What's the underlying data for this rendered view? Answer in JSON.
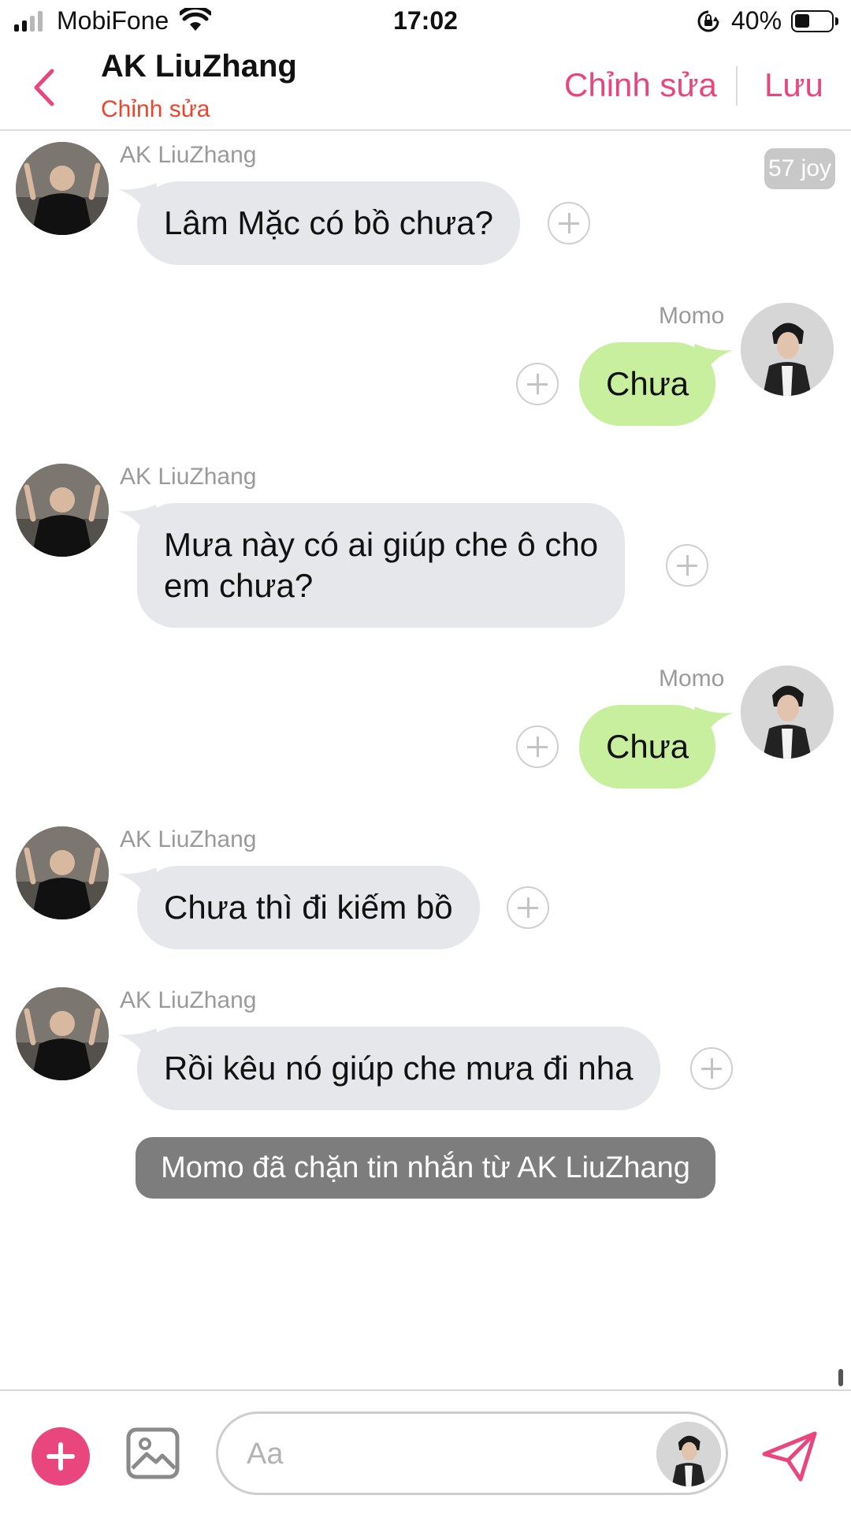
{
  "status_bar": {
    "carrier": "MobiFone",
    "time": "17:02",
    "battery_percent": "40%",
    "battery_level": 0.4,
    "signal_bars_active": 2,
    "icons": [
      "signal-icon",
      "wifi-icon",
      "rotation-lock-icon",
      "battery-icon"
    ]
  },
  "header": {
    "title": "AK LiuZhang",
    "subtitle": "Chỉnh sửa",
    "edit_label": "Chỉnh sửa",
    "save_label": "Lưu",
    "accent_color": "#e8467d",
    "subtitle_color": "#e8462d"
  },
  "messages": [
    {
      "sender": "AK LiuZhang",
      "side": "left",
      "lines": [
        "Lâm Mặc có bồ chưa?"
      ]
    },
    {
      "sender": "Momo",
      "side": "right",
      "lines": [
        "Chưa"
      ]
    },
    {
      "sender": "AK LiuZhang",
      "side": "left",
      "lines": [
        "Mưa này có ai giúp che ô cho",
        "em chưa?"
      ]
    },
    {
      "sender": "Momo",
      "side": "right",
      "lines": [
        "Chưa"
      ]
    },
    {
      "sender": "AK LiuZhang",
      "side": "left",
      "lines": [
        "Chưa thì đi kiếm bồ"
      ]
    },
    {
      "sender": "AK LiuZhang",
      "side": "left",
      "lines": [
        "Rồi kêu nó giúp che mưa đi nha"
      ]
    }
  ],
  "joy_badge": "57 joy",
  "system_note": "Momo đã chặn tin nhắn từ AK LiuZhang",
  "composer": {
    "placeholder": "Aa",
    "value": ""
  },
  "colors": {
    "left_bubble": "#e5e7ea",
    "right_bubble": "#c8ef9e",
    "system_note_bg": "#7d7d7d"
  }
}
